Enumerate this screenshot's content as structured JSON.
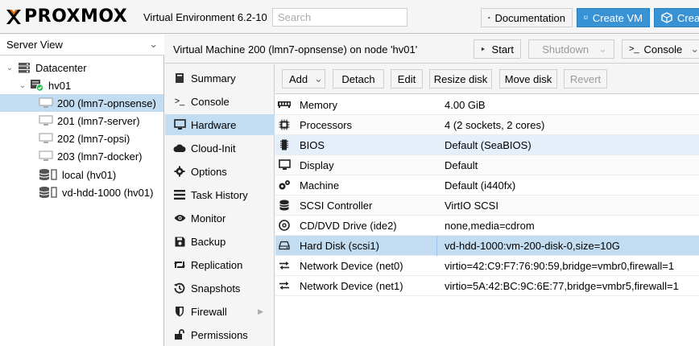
{
  "app": {
    "logo_text": "PROXMOX",
    "version": "Virtual Environment 6.2-10",
    "search_placeholder": "Search",
    "documentation": "Documentation",
    "create_vm": "Create VM",
    "create_ct": "Creat"
  },
  "sidebar": {
    "view": "Server View",
    "tree": [
      {
        "label": "Datacenter",
        "icon": "server-rack-icon"
      },
      {
        "label": "hv01",
        "icon": "node-online-icon"
      },
      {
        "label": "200 (lmn7-opnsense)",
        "icon": "monitor-icon",
        "selected": true
      },
      {
        "label": "201 (lmn7-server)",
        "icon": "monitor-icon"
      },
      {
        "label": "202 (lmn7-opsi)",
        "icon": "monitor-icon"
      },
      {
        "label": "203 (lmn7-docker)",
        "icon": "monitor-icon"
      },
      {
        "label": "local (hv01)",
        "icon": "storage-icon"
      },
      {
        "label": "vd-hdd-1000 (hv01)",
        "icon": "storage-icon"
      }
    ]
  },
  "header": {
    "title": "Virtual Machine 200 (lmn7-opnsense) on node 'hv01'",
    "start": "Start",
    "shutdown": "Shutdown",
    "console": "Console"
  },
  "nav": [
    {
      "label": "Summary",
      "icon": "book-icon"
    },
    {
      "label": "Console",
      "icon": "terminal-icon"
    },
    {
      "label": "Hardware",
      "icon": "desktop-icon",
      "selected": true
    },
    {
      "label": "Cloud-Init",
      "icon": "cloud-icon"
    },
    {
      "label": "Options",
      "icon": "gear-icon"
    },
    {
      "label": "Task History",
      "icon": "list-icon"
    },
    {
      "label": "Monitor",
      "icon": "eye-icon"
    },
    {
      "label": "Backup",
      "icon": "floppy-icon"
    },
    {
      "label": "Replication",
      "icon": "retweet-icon"
    },
    {
      "label": "Snapshots",
      "icon": "history-icon"
    },
    {
      "label": "Firewall",
      "icon": "shield-icon",
      "has_submenu": true
    },
    {
      "label": "Permissions",
      "icon": "unlock-icon"
    }
  ],
  "toolbar": {
    "add": "Add",
    "detach": "Detach",
    "edit": "Edit",
    "resize": "Resize disk",
    "move": "Move disk",
    "revert": "Revert"
  },
  "hardware": [
    {
      "name": "Memory",
      "value": "4.00 GiB",
      "icon": "memory-icon"
    },
    {
      "name": "Processors",
      "value": "4 (2 sockets, 2 cores)",
      "icon": "cpu-icon"
    },
    {
      "name": "BIOS",
      "value": "Default (SeaBIOS)",
      "icon": "microchip-icon"
    },
    {
      "name": "Display",
      "value": "Default",
      "icon": "desktop-icon"
    },
    {
      "name": "Machine",
      "value": "Default (i440fx)",
      "icon": "cogs-icon"
    },
    {
      "name": "SCSI Controller",
      "value": "VirtIO SCSI",
      "icon": "database-icon"
    },
    {
      "name": "CD/DVD Drive (ide2)",
      "value": "none,media=cdrom",
      "icon": "disc-icon"
    },
    {
      "name": "Hard Disk (scsi1)",
      "value": "vd-hdd-1000:vm-200-disk-0,size=10G",
      "icon": "hdd-icon",
      "selected": true
    },
    {
      "name": "Network Device (net0)",
      "value": "virtio=42:C9:F7:76:90:59,bridge=vmbr0,firewall=1",
      "icon": "exchange-icon"
    },
    {
      "name": "Network Device (net1)",
      "value": "virtio=5A:42:BC:9C:6E:77,bridge=vmbr5,firewall=1",
      "icon": "exchange-icon"
    }
  ],
  "colors": {
    "accent": "#e57000",
    "button_blue": "#3892d4",
    "selection": "#c2ddf2",
    "online": "#21bf4b"
  }
}
